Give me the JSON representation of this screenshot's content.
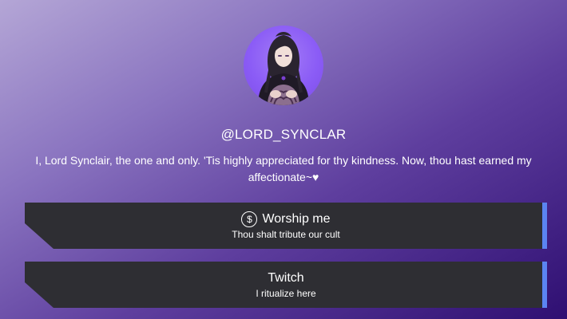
{
  "profile": {
    "handle": "@LORD_SYNCLAR",
    "bio": "I, Lord Synclair, the one and only. 'Tis highly appreciated for thy kindness. Now, thou hast earned my affectionate~♥",
    "avatar_icon": "character-portrait"
  },
  "links": [
    {
      "title": "Worship me",
      "subtitle": "Thou shalt tribute our cult",
      "icon": "dollar-icon"
    },
    {
      "title": "Twitch",
      "subtitle": "I ritualize here"
    }
  ],
  "colors": {
    "button_bg": "#2e2e33",
    "accent": "#5b84f2",
    "avatar_bg": "#8b5cf6"
  }
}
